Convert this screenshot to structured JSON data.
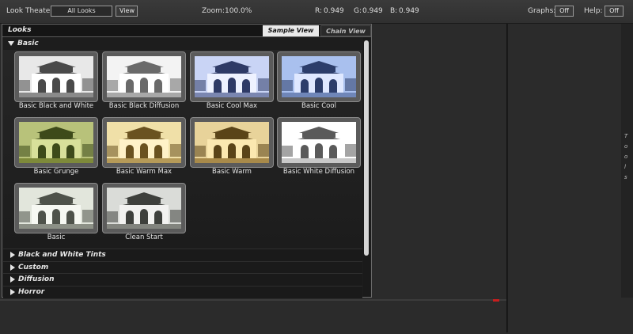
{
  "topbar": {
    "look_theater_label": "Look Theater:",
    "look_theater_value": "All Looks",
    "view_button": "View",
    "zoom_label": "Zoom:",
    "zoom_value": "100.0%",
    "r_label": "R:",
    "r_value": "0.949",
    "g_label": "G:",
    "g_value": "0.949",
    "b_label": "B:",
    "b_value": "0.949",
    "graphs_label": "Graphs:",
    "graphs_value": "Off",
    "help_label": "Help:",
    "help_value": "Off"
  },
  "panel": {
    "title": "Looks",
    "tabs": [
      {
        "label": "Sample View",
        "active": true
      },
      {
        "label": "Chain View",
        "active": false
      }
    ],
    "open_category": "Basic",
    "looks": [
      {
        "label": "Basic Black and White",
        "tint": "bw"
      },
      {
        "label": "Basic Black Diffusion",
        "tint": "bwlight"
      },
      {
        "label": "Basic Cool Max",
        "tint": "coolmax"
      },
      {
        "label": "Basic Cool",
        "tint": "cool"
      },
      {
        "label": "Basic Grunge",
        "tint": "grunge"
      },
      {
        "label": "Basic Warm Max",
        "tint": "warmmax"
      },
      {
        "label": "Basic Warm",
        "tint": "warm"
      },
      {
        "label": "Basic White Diffusion",
        "tint": "white"
      },
      {
        "label": "Basic",
        "tint": "basic"
      },
      {
        "label": "Clean Start",
        "tint": "clean"
      }
    ],
    "collapsed_categories": [
      "Black and White Tints",
      "Custom",
      "Diffusion",
      "Horror"
    ]
  },
  "tools": {
    "letters": [
      "T",
      "o",
      "o",
      "l",
      "s"
    ]
  },
  "colors": {
    "background": "#2b2b2b",
    "panel": "#1d1d1d",
    "active_tab": "#e9e9e9",
    "red_marker": "#c81e1e"
  },
  "icons": {
    "expanded": "triangle-down-icon",
    "collapsed": "triangle-right-icon"
  }
}
